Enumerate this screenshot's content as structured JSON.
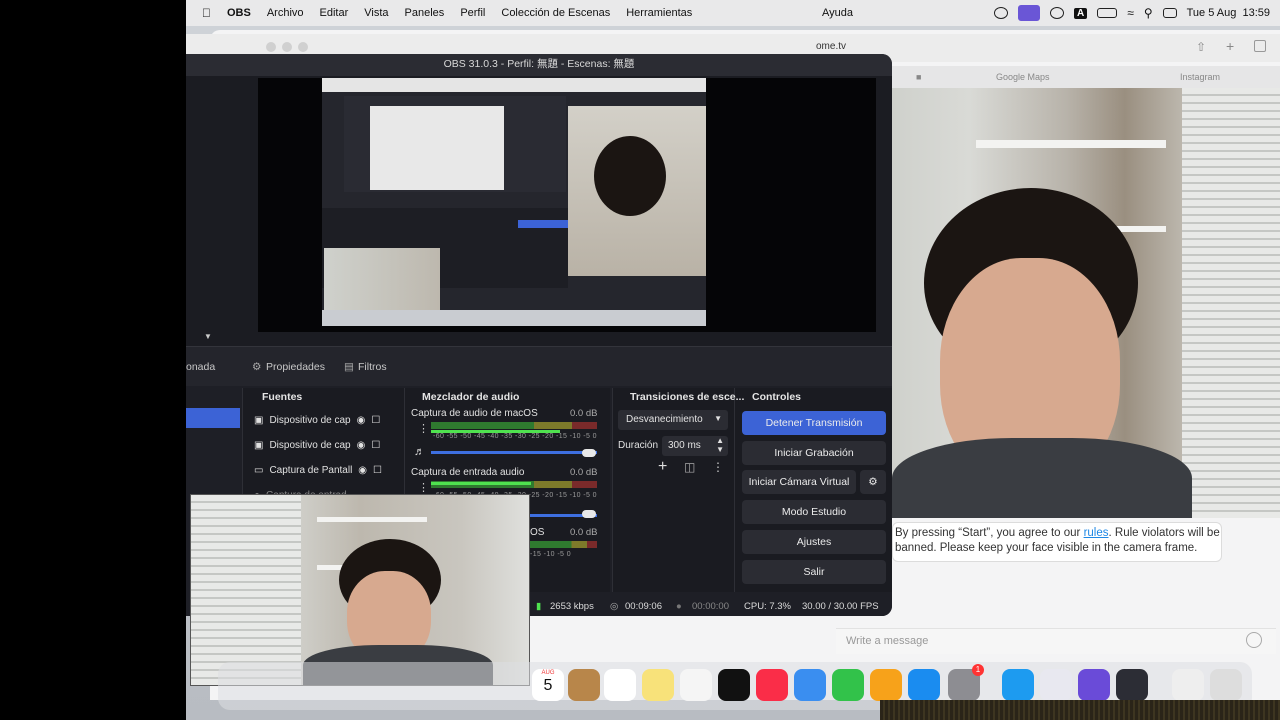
{
  "menubar": {
    "app": "OBS",
    "items": [
      "Archivo",
      "Editar",
      "Vista",
      "Paneles",
      "Perfil",
      "Colección de Escenas",
      "Herramientas"
    ],
    "ayuda": "Ayuda",
    "clock": "Tue 5 Aug  13:59",
    "input_source": "A"
  },
  "browser": {
    "url": "ome.tv",
    "tabs": [
      "Google Maps",
      "Instagram"
    ]
  },
  "obs": {
    "title": "OBS 31.0.3 - Perfil: 無題 - Escenas: 無題",
    "scene_label": "onada",
    "properties_button": "Propiedades",
    "filters_button": "Filtros",
    "docks": {
      "sources_title": "Fuentes",
      "mixer_title": "Mezclador de audio",
      "transitions_title": "Transiciones de esce...",
      "controls_title": "Controles"
    },
    "sources": [
      "Dispositivo de cap",
      "Dispositivo de cap",
      "Captura de Pantall",
      "Captura de entrad"
    ],
    "mixer": [
      {
        "name": "Captura de audio de macOS",
        "db": "0.0 dB",
        "level": 0.78
      },
      {
        "name": "Captura de entrada audio",
        "db": "0.0 dB",
        "level": 0.6
      },
      {
        "name": "OS",
        "db": "0.0 dB",
        "level": 0.7
      }
    ],
    "meter_scale": "-60 -55 -50 -45 -40 -35 -30 -25 -20 -15 -10 -5 0",
    "transition": {
      "type": "Desvanecimiento",
      "duration_label": "Duración",
      "duration_value": "300 ms"
    },
    "controls": [
      "Detener Transmisión",
      "Iniciar Grabación",
      "Iniciar Cámara Virtual",
      "Modo Estudio",
      "Ajustes",
      "Salir"
    ],
    "status": {
      "bitrate": "2653 kbps",
      "stream_time": "00:09:06",
      "record_time": "00:00:00",
      "cpu": "CPU: 7.3%",
      "fps": "30.00 / 30.00 FPS"
    }
  },
  "chat": {
    "notice_pre": "By pressing “Start”, you agree to our ",
    "notice_link": "rules",
    "notice_post": ". Rule violators will be banned. Please keep your face visible in the camera frame.",
    "input_placeholder": "Write a message"
  },
  "dock": {
    "calendar_month": "AUG",
    "calendar_day": "5",
    "badge_count": "1"
  },
  "colors": {
    "obs_primary": "#3c63d6",
    "obs_bg": "#1e1f26",
    "link": "#1e88e5"
  }
}
